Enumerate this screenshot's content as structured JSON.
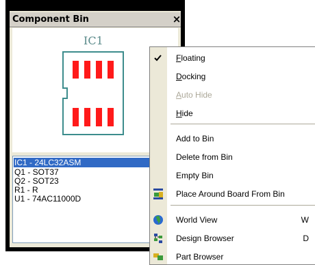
{
  "bin": {
    "title": "Component Bin",
    "close_glyph": "×",
    "preview_label": "IC1",
    "components": [
      {
        "label": "IC1 - 24LC32ASM",
        "selected": true
      },
      {
        "label": "Q1 - SOT37",
        "selected": false
      },
      {
        "label": "Q2 - SOT23",
        "selected": false
      },
      {
        "label": "R1 - R",
        "selected": false
      },
      {
        "label": "U1 - 74AC11000D",
        "selected": false
      }
    ]
  },
  "menu": {
    "floating_first": "F",
    "floating_rest": "loating",
    "docking_first": "D",
    "docking_rest": "ocking",
    "autohide_first": "A",
    "autohide_rest": "uto Hide",
    "hide_first": "H",
    "hide_rest": "ide",
    "add_to_bin": "Add to Bin",
    "delete_from_bin": "Delete from Bin",
    "empty_bin": "Empty Bin",
    "place_around_board": "Place Around Board From Bin",
    "world_view": "World View",
    "world_view_shortcut": "W",
    "design_browser": "Design Browser",
    "design_browser_shortcut": "D",
    "next_item_partial": "Part Browser"
  },
  "colors": {
    "pad_red": "#ff1a1a",
    "outline_teal": "#3c8c8c",
    "selection_blue": "#316ac5",
    "menu_gutter": "#ece9d8",
    "disabled_text": "#aca899"
  }
}
